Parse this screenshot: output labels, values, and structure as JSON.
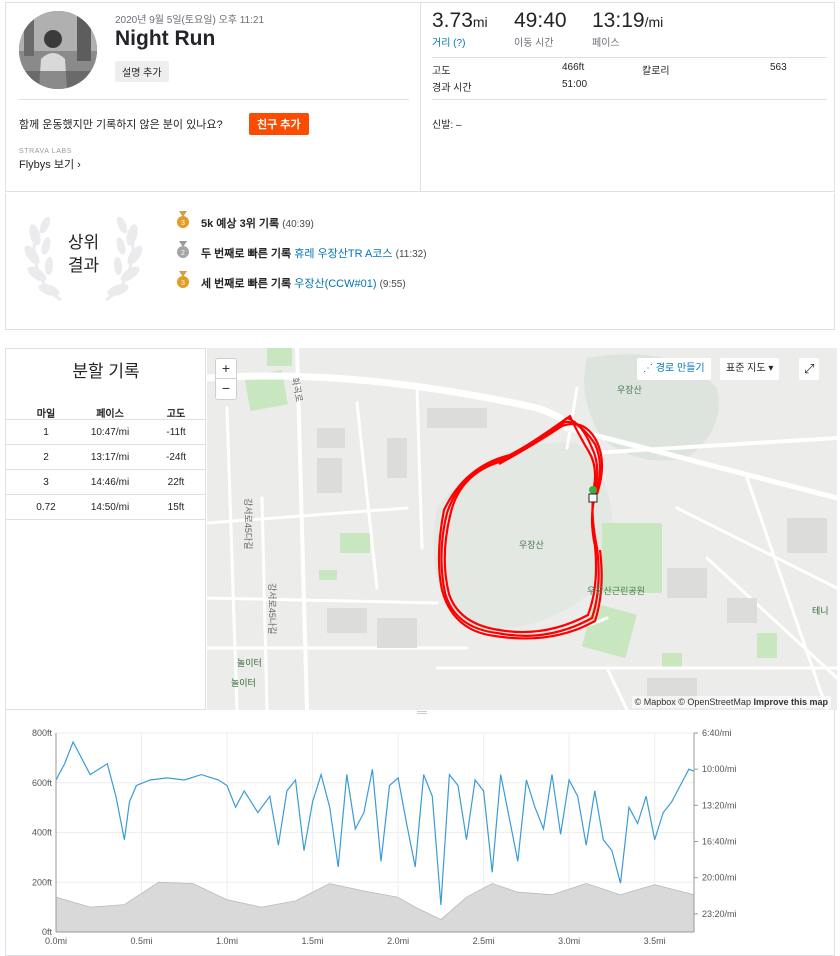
{
  "activity": {
    "timestamp": "2020년 9월 5일(토요일) 오후 11:21",
    "title": "Night Run",
    "desc_button": "설명 추가",
    "ask_text": "함께 운동했지만 기록하지 않은 분이 있나요?",
    "add_friend": "친구 추가",
    "labs_label": "STRAVA LABS",
    "flybys_label": "Flybys 보기 ›"
  },
  "stats": {
    "distance": {
      "value": "3.73",
      "unit": "mi",
      "label": "거리 (?)"
    },
    "moving_time": {
      "value": "49:40",
      "label": "이동 시간"
    },
    "pace": {
      "value": "13:19",
      "unit": "/mi",
      "label": "페이스"
    },
    "elevation_label": "고도",
    "elevation_value": "466ft",
    "calories_label": "칼로리",
    "calories_value": "563",
    "elapsed_label": "경과 시간",
    "elapsed_value": "51:00",
    "device_label": "신발: –"
  },
  "achievements": {
    "badge": [
      "상위",
      "결과"
    ],
    "items": [
      {
        "medal": "gold",
        "rank": "3",
        "title": "5k 예상 3위 기록",
        "segment": "",
        "time": "(40:39)"
      },
      {
        "medal": "silver",
        "rank": "2",
        "title": "두 번째로 빠른 기록",
        "segment": "휴레 우장산TR A코스",
        "time": "(11:32)"
      },
      {
        "medal": "gold",
        "rank": "3",
        "title": "세 번째로 빠른 기록",
        "segment": "우장산(CCW#01)",
        "time": "(9:55)"
      }
    ]
  },
  "splits": {
    "title": "분할 기록",
    "headers": [
      "마일",
      "페이스",
      "고도"
    ],
    "rows": [
      [
        "1",
        "10:47/mi",
        "-11ft"
      ],
      [
        "2",
        "13:17/mi",
        "-24ft"
      ],
      [
        "3",
        "14:46/mi",
        "22ft"
      ],
      [
        "0.72",
        "14:50/mi",
        "15ft"
      ]
    ]
  },
  "map": {
    "zoom_in": "+",
    "zoom_out": "−",
    "route_builder": "경로 만들기",
    "map_type": "표준 지도 ▾",
    "expand": "⤢",
    "labels": [
      "우장산",
      "우장산",
      "우장산근린공원",
      "놀이터",
      "놀이터",
      "테니",
      "강서로45다길",
      "강서로45나길",
      "화곡로"
    ],
    "attribution": "© Mapbox © OpenStreetMap",
    "improve": "Improve this map",
    "route_color": "#ff0000",
    "park_color": "#c8e6c0"
  },
  "chart_data": {
    "type": "line",
    "x_ticks": [
      "0.0mi",
      "0.5mi",
      "1.0mi",
      "1.5mi",
      "2.0mi",
      "2.5mi",
      "3.0mi",
      "3.5mi"
    ],
    "xlim": [
      0,
      3.73
    ],
    "elevation": {
      "name": "고도",
      "y_ticks": [
        "0ft",
        "200ft",
        "400ft",
        "600ft",
        "800ft"
      ],
      "ylim": [
        0,
        800
      ],
      "color": "#d9d9d9",
      "x": [
        0,
        0.2,
        0.4,
        0.6,
        0.8,
        1.0,
        1.2,
        1.4,
        1.6,
        1.8,
        2.0,
        2.1,
        2.25,
        2.4,
        2.55,
        2.7,
        2.9,
        3.1,
        3.3,
        3.5,
        3.73
      ],
      "values": [
        140,
        100,
        110,
        200,
        195,
        130,
        100,
        125,
        195,
        165,
        140,
        100,
        50,
        140,
        195,
        160,
        150,
        195,
        150,
        190,
        150
      ]
    },
    "pace": {
      "name": "페이스",
      "y_ticks": [
        "6:40/mi",
        "10:00/mi",
        "13:20/mi",
        "16:40/mi",
        "20:00/mi",
        "23:20/mi"
      ],
      "color": "#3a9bd8",
      "x": [
        0,
        0.05,
        0.1,
        0.2,
        0.3,
        0.35,
        0.4,
        0.43,
        0.47,
        0.55,
        0.65,
        0.75,
        0.85,
        0.95,
        1.0,
        1.05,
        1.1,
        1.18,
        1.25,
        1.3,
        1.35,
        1.4,
        1.45,
        1.5,
        1.55,
        1.6,
        1.65,
        1.7,
        1.75,
        1.8,
        1.85,
        1.9,
        1.95,
        2.0,
        2.05,
        2.1,
        2.15,
        2.2,
        2.25,
        2.3,
        2.35,
        2.4,
        2.45,
        2.5,
        2.55,
        2.6,
        2.65,
        2.7,
        2.75,
        2.8,
        2.85,
        2.9,
        2.95,
        3.0,
        3.05,
        3.1,
        3.15,
        3.2,
        3.25,
        3.3,
        3.35,
        3.4,
        3.45,
        3.5,
        3.55,
        3.6,
        3.65,
        3.7,
        3.73
      ],
      "values": [
        11.0,
        9.5,
        7.5,
        10.5,
        9.5,
        12.5,
        16.5,
        13.0,
        11.5,
        11.0,
        10.8,
        11.0,
        10.5,
        11.0,
        11.5,
        13.5,
        12.0,
        14.0,
        12.5,
        17.0,
        12.0,
        11.0,
        17.5,
        13.0,
        10.5,
        13.5,
        19.0,
        10.5,
        15.5,
        14.0,
        10.0,
        18.5,
        11.5,
        10.8,
        15.0,
        19.0,
        10.5,
        12.5,
        22.5,
        10.5,
        11.5,
        16.5,
        11.0,
        12.0,
        19.5,
        10.5,
        14.5,
        18.5,
        11.0,
        13.5,
        15.5,
        10.5,
        16.0,
        11.0,
        12.5,
        17.0,
        12.0,
        16.5,
        17.5,
        20.5,
        13.5,
        15.0,
        12.5,
        16.5,
        14.0,
        13.0,
        11.5,
        10.0,
        10.2
      ]
    }
  }
}
